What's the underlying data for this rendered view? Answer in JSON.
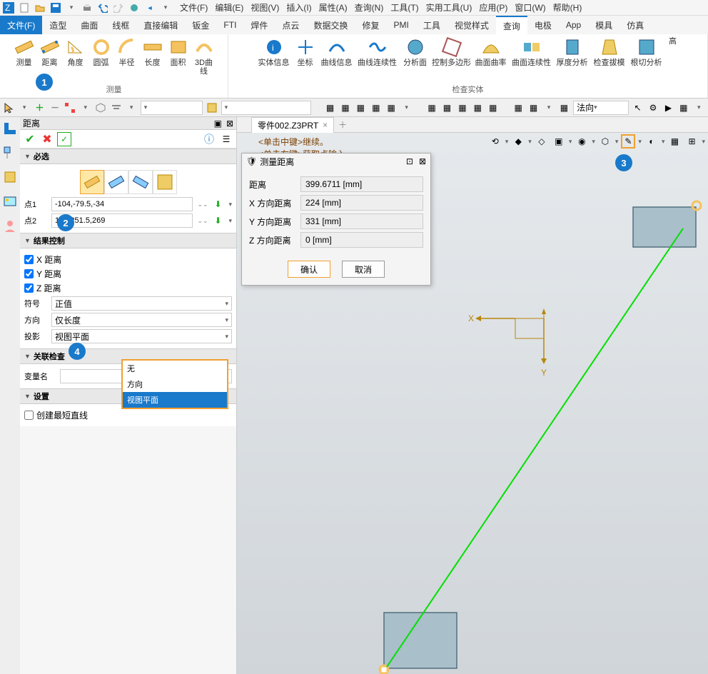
{
  "menus": {
    "file": "文件(F)",
    "edit": "编辑(E)",
    "view": "视图(V)",
    "insert": "插入(I)",
    "attr": "属性(A)",
    "query": "查询(N)",
    "tools": "工具(T)",
    "util": "实用工具(U)",
    "apps": "应用(P)",
    "window": "窗口(W)",
    "help": "帮助(H)"
  },
  "tabs": {
    "file": "文件(F)",
    "shape": "造型",
    "surface": "曲面",
    "wire": "线框",
    "directedit": "直接编辑",
    "sheetmetal": "钣金",
    "fti": "FTI",
    "weld": "焊件",
    "pointcloud": "点云",
    "dataex": "数据交换",
    "repair": "修复",
    "pmi": "PMI",
    "tools": "工具",
    "vstyle": "视觉样式",
    "query": "查询",
    "electrode": "电极",
    "app": "App",
    "mold": "模具",
    "sim": "仿真"
  },
  "ribbon": {
    "measure": {
      "label": "测量",
      "btns": {
        "measure": "测量",
        "distance": "距离",
        "angle": "角度",
        "arc": "圆弧",
        "radius": "半径",
        "length": "长度",
        "area": "面积",
        "curve3d": "3D曲线"
      }
    },
    "inspect": {
      "label": "检查实体",
      "btns": {
        "entityinfo": "实体信息",
        "coord": "坐标",
        "curveinfo": "曲线信息",
        "curvecont": "曲线连续性",
        "section": "分析面",
        "ctrlpoly": "控制多边形",
        "surfcurv": "曲面曲率",
        "surfcont": "曲面连续性",
        "thickness": "厚度分析",
        "draft": "检查拔模",
        "undercut": "根切分析",
        "more": "高"
      }
    }
  },
  "toolrow": {
    "normal": "法向"
  },
  "panel": {
    "title": "距离",
    "sections": {
      "required": "必选",
      "resultctrl": "结果控制",
      "linkcheck": "关联检查",
      "settings": "设置"
    },
    "pt1_label": "点1",
    "pt1": "-104,-79.5,-34",
    "pt2_label": "点2",
    "pt2": "120,251.5,269",
    "xdist": "X 距离",
    "ydist": "Y 距离",
    "zdist": "Z 距离",
    "sign_label": "符号",
    "sign": "正值",
    "dir_label": "方向",
    "dir": "仅长度",
    "proj_label": "投影",
    "proj": "视图平面",
    "proj_options": {
      "none": "无",
      "direction": "方向",
      "viewplane": "视图平面"
    },
    "varname_label": "变量名",
    "createline": "创建最短直线"
  },
  "doc": {
    "tab": "零件002.Z3PRT"
  },
  "hints": {
    "l1": "<单击中键>继续。",
    "l2": "<单击右键>获取点输入。"
  },
  "dialog": {
    "title": "测量距离",
    "rows": {
      "dist_l": "距离",
      "dist_v": "399.6711  [mm]",
      "xl": "X 方向距离",
      "xv": "224  [mm]",
      "yl": "Y 方向距离",
      "yv": "331  [mm]",
      "zl": "Z 方向距离",
      "zv": "0  [mm]"
    },
    "ok": "确认",
    "cancel": "取消"
  },
  "axis": {
    "x": "X",
    "y": "Y"
  },
  "callouts": {
    "c1": "1",
    "c2": "2",
    "c3": "3",
    "c4": "4"
  }
}
